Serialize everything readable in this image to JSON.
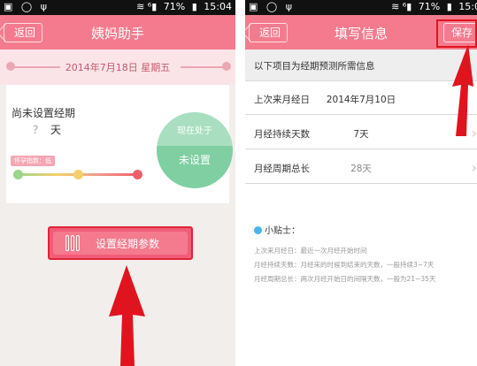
{
  "status_bar": {
    "left_icons": "▣ ◯ ψ",
    "signal": "≋ ⁶▮",
    "battery_pct": "71%",
    "left_time": "15:04",
    "right_time": "15:0"
  },
  "left_screen": {
    "title": "姨妈助手",
    "back_label": "返回",
    "date": "2014年7月18日    星期五",
    "status_text": "尚未设置经期",
    "days_question": "？",
    "days_unit": "天",
    "period_tag": "怀孕指数：低",
    "circle_caption": "现在处于",
    "circle_status": "未设置",
    "set_button_label": "设置经期参数",
    "slider_colors": [
      "#9cd68c",
      "#f5d06a",
      "#f0606a"
    ]
  },
  "right_screen": {
    "title": "填写信息",
    "back_label": "返回",
    "save_label": "保存",
    "section_header": "以下项目为经期预测所需信息",
    "rows": [
      {
        "label": "上次来月经日",
        "value": "2014年7月10日",
        "chevron": "›"
      },
      {
        "label": "月经持续天数",
        "value": "7天",
        "chevron": "›"
      },
      {
        "label": "月经周期总长",
        "value": "28天",
        "chevron": "›"
      }
    ],
    "tips_title": "小贴士：",
    "tips": [
      "上次来月经日：最近一次月经开始时间",
      "月经持续天数：月经来的时候到结束的天数，一般持续3~7天",
      "月经周期总长：两次月经开始日的间隔天数，一般为21~35天"
    ]
  },
  "colors": {
    "accent_pink": "#f47b8d",
    "arrow_red": "#e0141f",
    "circle_green": "#7fcfa3",
    "tip_blue": "#4ab4e8"
  }
}
